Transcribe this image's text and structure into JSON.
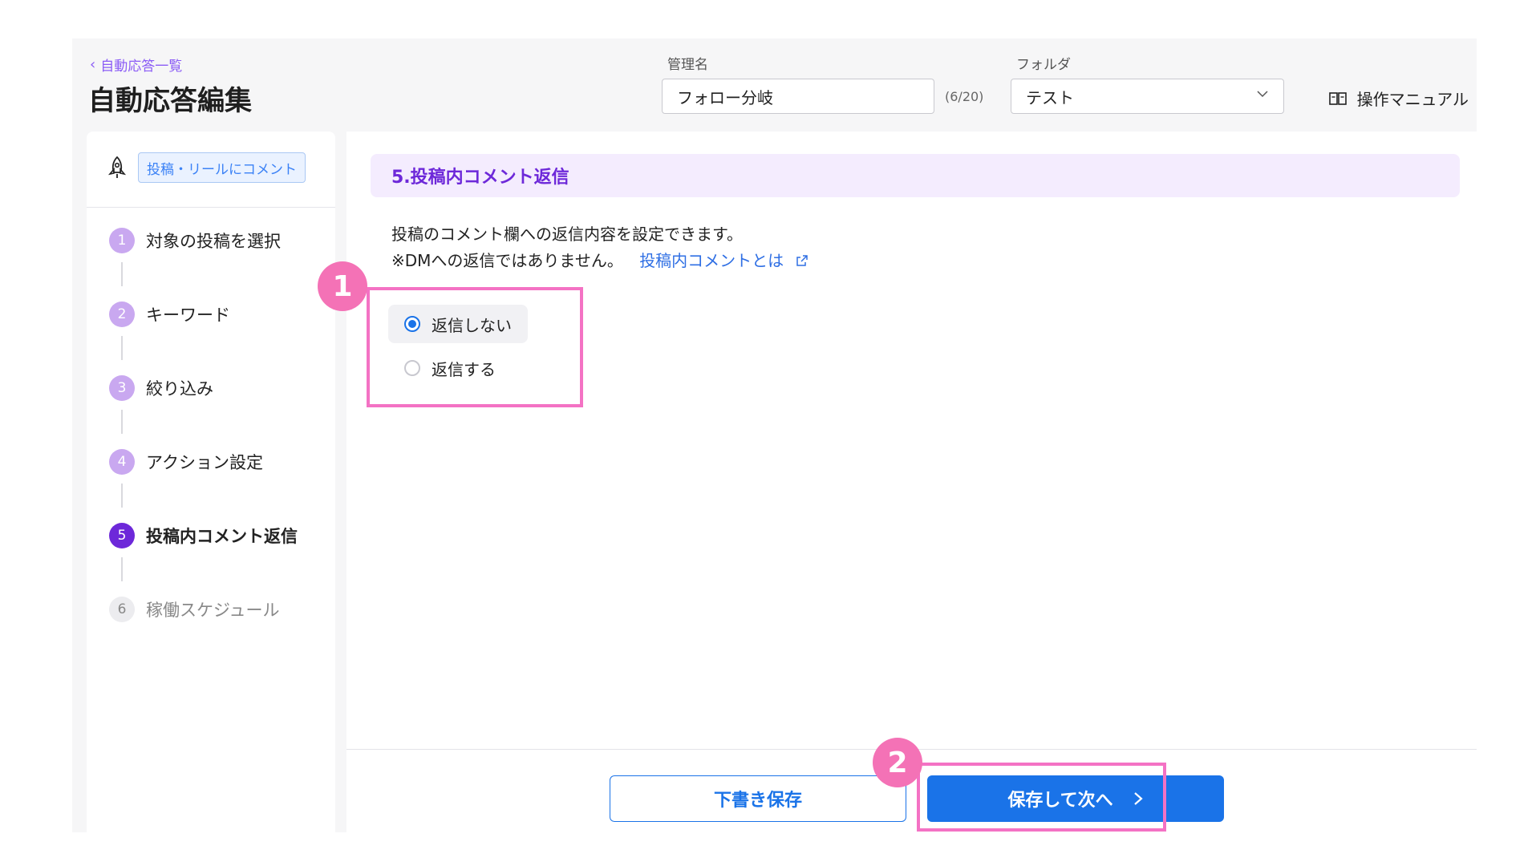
{
  "header": {
    "back_label": "自動応答一覧",
    "title": "自動応答編集",
    "name_label": "管理名",
    "name_value": "フォロー分岐",
    "name_counter": "(6/20)",
    "folder_label": "フォルダ",
    "folder_value": "テスト",
    "manual_label": "操作マニュアル"
  },
  "sidebar": {
    "trigger_badge": "投稿・リールにコメント",
    "steps": [
      {
        "num": "1",
        "label": "対象の投稿を選択"
      },
      {
        "num": "2",
        "label": "キーワード"
      },
      {
        "num": "3",
        "label": "絞り込み"
      },
      {
        "num": "4",
        "label": "アクション設定"
      },
      {
        "num": "5",
        "label": "投稿内コメント返信"
      },
      {
        "num": "6",
        "label": "稼働スケジュール"
      }
    ]
  },
  "main": {
    "section_title": "5.投稿内コメント返信",
    "desc_line1": "投稿のコメント欄への返信内容を設定できます。",
    "desc_line2": "※DMへの返信ではありません。",
    "help_link": "投稿内コメントとは",
    "options": [
      {
        "label": "返信しない",
        "selected": true
      },
      {
        "label": "返信する",
        "selected": false
      }
    ],
    "draft_button": "下書き保存",
    "next_button": "保存して次へ"
  },
  "annotations": [
    "1",
    "2"
  ],
  "colors": {
    "accent_blue": "#1a73e8",
    "accent_purple": "#6d28d9",
    "annotation_pink": "#f472b6"
  }
}
